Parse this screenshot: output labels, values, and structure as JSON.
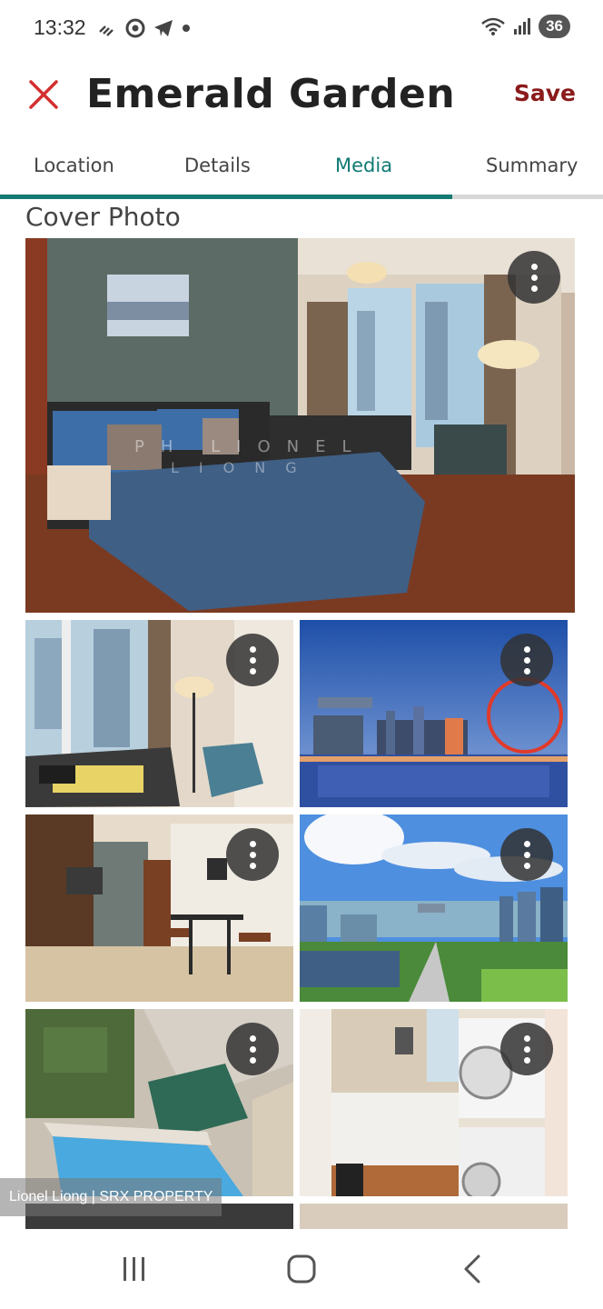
{
  "status_bar": {
    "time": "13:32",
    "battery": "36",
    "icons_left": [
      "missed-call-icon",
      "chrome-icon",
      "telegram-icon",
      "dot-icon"
    ],
    "icons_right": [
      "wifi-icon",
      "signal-icon",
      "battery-icon"
    ]
  },
  "app_bar": {
    "title": "Emerald Garden",
    "save_label": "Save",
    "close_icon": "close-icon"
  },
  "tabs": [
    {
      "label": "Location",
      "active": false
    },
    {
      "label": "Details",
      "active": false
    },
    {
      "label": "Media",
      "active": true
    },
    {
      "label": "Summary",
      "active": false
    }
  ],
  "section": {
    "title": "Cover Photo"
  },
  "photos": [
    {
      "subject": "bedroom",
      "watermark": "PH LIONEL LIONG"
    },
    {
      "subject": "study-corner"
    },
    {
      "subject": "marina-bay-night"
    },
    {
      "subject": "dining-nook"
    },
    {
      "subject": "city-skyline-day"
    },
    {
      "subject": "pool-aerial"
    },
    {
      "subject": "laundry-balcony"
    }
  ],
  "overlay_text": "Lionel Liong | SRX PROPERTY",
  "nav_bar": {
    "items": [
      "recent-apps-icon",
      "home-icon",
      "back-icon"
    ]
  },
  "colors": {
    "accent": "#137a74",
    "save": "#8b1a1a",
    "close": "#d32f2f"
  }
}
